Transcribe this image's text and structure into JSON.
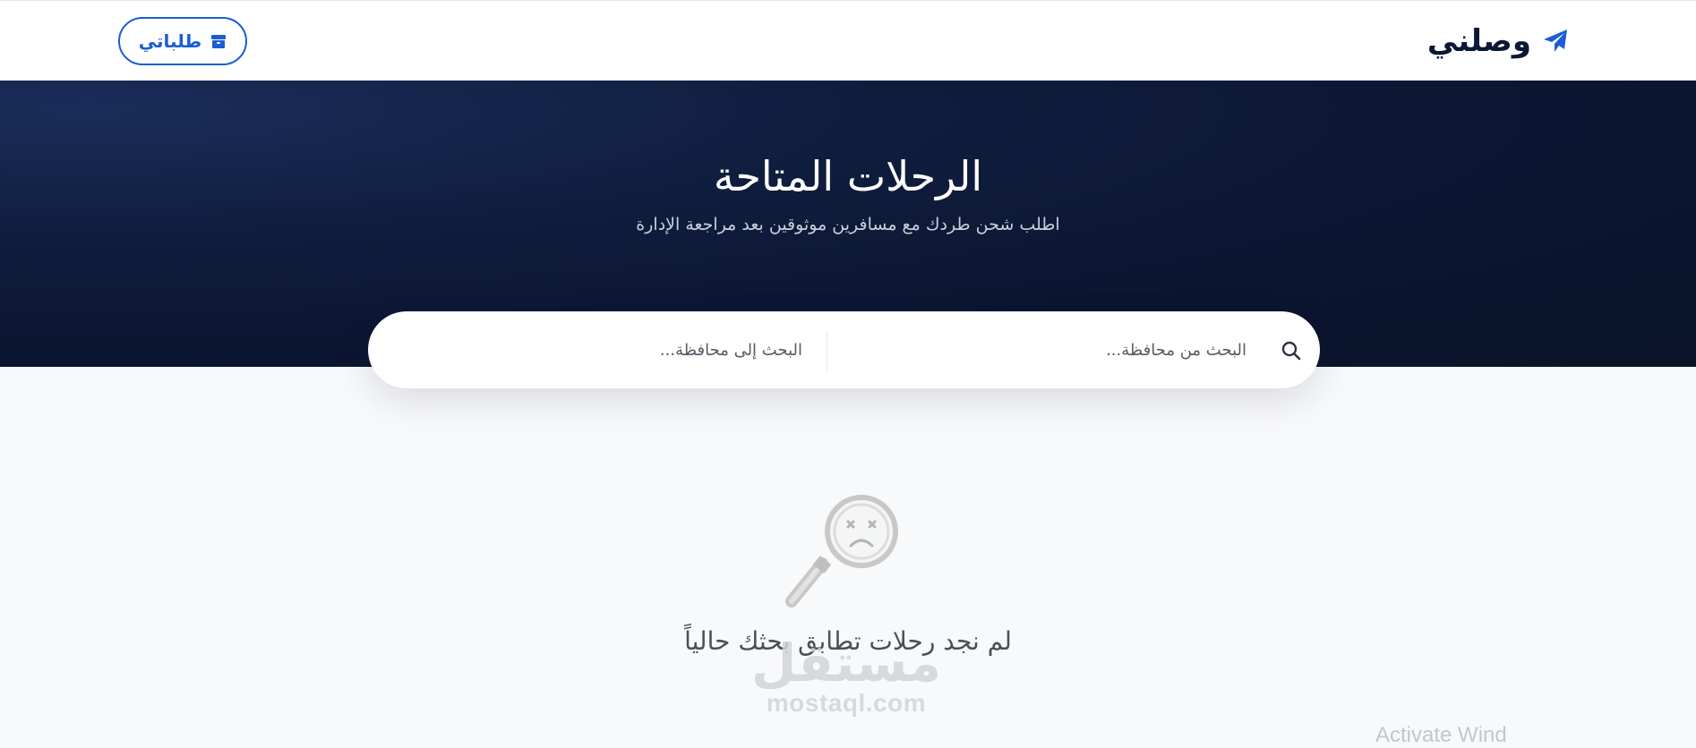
{
  "header": {
    "brand_name": "وصلني",
    "brand_icon": "paper-plane-icon",
    "orders_button_label": "طلباتي",
    "orders_button_icon": "box-icon",
    "accent_color": "#1a5dd6",
    "brand_text_color": "#0b1733"
  },
  "hero": {
    "title": "الرحلات المتاحة",
    "subtitle": "اطلب شحن طردك مع مسافرين موثوقين بعد مراجعة الإدارة",
    "background_color": "#0b1530"
  },
  "search": {
    "from_placeholder": "البحث من محافظة...",
    "from_value": "",
    "to_placeholder": "البحث إلى محافظة...",
    "to_value": "",
    "icon": "search-icon"
  },
  "empty_state": {
    "icon": "sad-magnifier-icon",
    "message": "لم نجد رحلات تطابق بحثك حالياً"
  },
  "watermark": {
    "arabic": "مستقل",
    "english": "mostaql.com"
  },
  "overlay": {
    "activate_text": "Activate Wind"
  }
}
